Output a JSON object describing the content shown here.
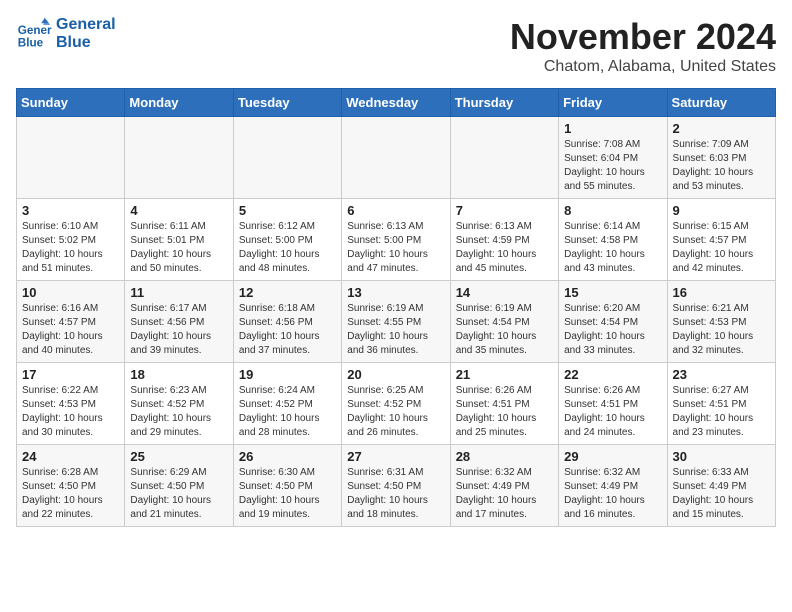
{
  "logo": {
    "line1": "General",
    "line2": "Blue"
  },
  "title": "November 2024",
  "location": "Chatom, Alabama, United States",
  "weekdays": [
    "Sunday",
    "Monday",
    "Tuesday",
    "Wednesday",
    "Thursday",
    "Friday",
    "Saturday"
  ],
  "weeks": [
    [
      {
        "day": "",
        "content": ""
      },
      {
        "day": "",
        "content": ""
      },
      {
        "day": "",
        "content": ""
      },
      {
        "day": "",
        "content": ""
      },
      {
        "day": "",
        "content": ""
      },
      {
        "day": "1",
        "content": "Sunrise: 7:08 AM\nSunset: 6:04 PM\nDaylight: 10 hours\nand 55 minutes."
      },
      {
        "day": "2",
        "content": "Sunrise: 7:09 AM\nSunset: 6:03 PM\nDaylight: 10 hours\nand 53 minutes."
      }
    ],
    [
      {
        "day": "3",
        "content": "Sunrise: 6:10 AM\nSunset: 5:02 PM\nDaylight: 10 hours\nand 51 minutes."
      },
      {
        "day": "4",
        "content": "Sunrise: 6:11 AM\nSunset: 5:01 PM\nDaylight: 10 hours\nand 50 minutes."
      },
      {
        "day": "5",
        "content": "Sunrise: 6:12 AM\nSunset: 5:00 PM\nDaylight: 10 hours\nand 48 minutes."
      },
      {
        "day": "6",
        "content": "Sunrise: 6:13 AM\nSunset: 5:00 PM\nDaylight: 10 hours\nand 47 minutes."
      },
      {
        "day": "7",
        "content": "Sunrise: 6:13 AM\nSunset: 4:59 PM\nDaylight: 10 hours\nand 45 minutes."
      },
      {
        "day": "8",
        "content": "Sunrise: 6:14 AM\nSunset: 4:58 PM\nDaylight: 10 hours\nand 43 minutes."
      },
      {
        "day": "9",
        "content": "Sunrise: 6:15 AM\nSunset: 4:57 PM\nDaylight: 10 hours\nand 42 minutes."
      }
    ],
    [
      {
        "day": "10",
        "content": "Sunrise: 6:16 AM\nSunset: 4:57 PM\nDaylight: 10 hours\nand 40 minutes."
      },
      {
        "day": "11",
        "content": "Sunrise: 6:17 AM\nSunset: 4:56 PM\nDaylight: 10 hours\nand 39 minutes."
      },
      {
        "day": "12",
        "content": "Sunrise: 6:18 AM\nSunset: 4:56 PM\nDaylight: 10 hours\nand 37 minutes."
      },
      {
        "day": "13",
        "content": "Sunrise: 6:19 AM\nSunset: 4:55 PM\nDaylight: 10 hours\nand 36 minutes."
      },
      {
        "day": "14",
        "content": "Sunrise: 6:19 AM\nSunset: 4:54 PM\nDaylight: 10 hours\nand 35 minutes."
      },
      {
        "day": "15",
        "content": "Sunrise: 6:20 AM\nSunset: 4:54 PM\nDaylight: 10 hours\nand 33 minutes."
      },
      {
        "day": "16",
        "content": "Sunrise: 6:21 AM\nSunset: 4:53 PM\nDaylight: 10 hours\nand 32 minutes."
      }
    ],
    [
      {
        "day": "17",
        "content": "Sunrise: 6:22 AM\nSunset: 4:53 PM\nDaylight: 10 hours\nand 30 minutes."
      },
      {
        "day": "18",
        "content": "Sunrise: 6:23 AM\nSunset: 4:52 PM\nDaylight: 10 hours\nand 29 minutes."
      },
      {
        "day": "19",
        "content": "Sunrise: 6:24 AM\nSunset: 4:52 PM\nDaylight: 10 hours\nand 28 minutes."
      },
      {
        "day": "20",
        "content": "Sunrise: 6:25 AM\nSunset: 4:52 PM\nDaylight: 10 hours\nand 26 minutes."
      },
      {
        "day": "21",
        "content": "Sunrise: 6:26 AM\nSunset: 4:51 PM\nDaylight: 10 hours\nand 25 minutes."
      },
      {
        "day": "22",
        "content": "Sunrise: 6:26 AM\nSunset: 4:51 PM\nDaylight: 10 hours\nand 24 minutes."
      },
      {
        "day": "23",
        "content": "Sunrise: 6:27 AM\nSunset: 4:51 PM\nDaylight: 10 hours\nand 23 minutes."
      }
    ],
    [
      {
        "day": "24",
        "content": "Sunrise: 6:28 AM\nSunset: 4:50 PM\nDaylight: 10 hours\nand 22 minutes."
      },
      {
        "day": "25",
        "content": "Sunrise: 6:29 AM\nSunset: 4:50 PM\nDaylight: 10 hours\nand 21 minutes."
      },
      {
        "day": "26",
        "content": "Sunrise: 6:30 AM\nSunset: 4:50 PM\nDaylight: 10 hours\nand 19 minutes."
      },
      {
        "day": "27",
        "content": "Sunrise: 6:31 AM\nSunset: 4:50 PM\nDaylight: 10 hours\nand 18 minutes."
      },
      {
        "day": "28",
        "content": "Sunrise: 6:32 AM\nSunset: 4:49 PM\nDaylight: 10 hours\nand 17 minutes."
      },
      {
        "day": "29",
        "content": "Sunrise: 6:32 AM\nSunset: 4:49 PM\nDaylight: 10 hours\nand 16 minutes."
      },
      {
        "day": "30",
        "content": "Sunrise: 6:33 AM\nSunset: 4:49 PM\nDaylight: 10 hours\nand 15 minutes."
      }
    ]
  ]
}
